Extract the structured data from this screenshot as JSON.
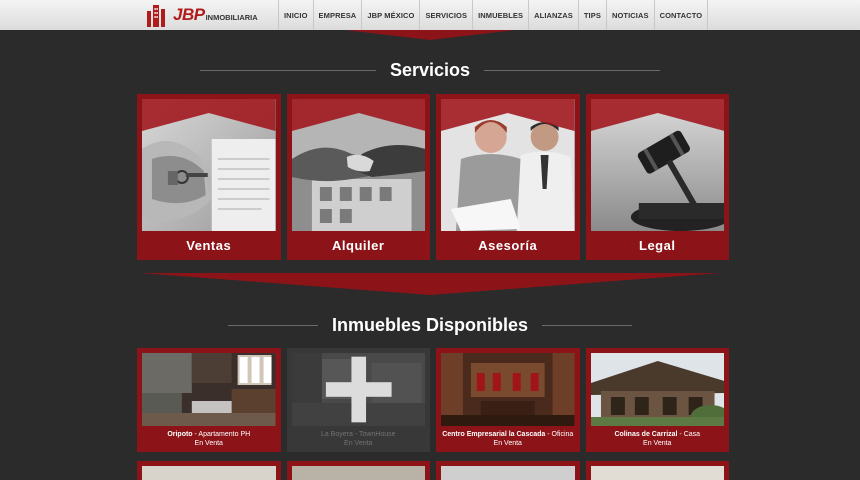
{
  "brand": {
    "name": "JBP",
    "tagline": "INMOBILIARIA",
    "color": "#b01c1c"
  },
  "nav": {
    "items": [
      {
        "label": "INICIO"
      },
      {
        "label": "EMPRESA"
      },
      {
        "label": "JBP MÉXICO"
      },
      {
        "label": "SERVICIOS"
      },
      {
        "label": "INMUEBLES"
      },
      {
        "label": "ALIANZAS"
      },
      {
        "label": "TIPS"
      },
      {
        "label": "NOTICIAS"
      },
      {
        "label": "CONTACTO"
      }
    ]
  },
  "services": {
    "title": "Servicios",
    "items": [
      {
        "label": "Ventas",
        "icon": "keys-handing-photo"
      },
      {
        "label": "Alquiler",
        "icon": "handshake-photo"
      },
      {
        "label": "Asesoría",
        "icon": "consulting-people-photo"
      },
      {
        "label": "Legal",
        "icon": "gavel-photo"
      }
    ]
  },
  "properties": {
    "title": "Inmuebles Disponibles",
    "items": [
      {
        "name": "Oripoto",
        "type": " - Apartamento PH",
        "status": "En Venta",
        "icon": "living-room-photo"
      },
      {
        "name": "La Boyera",
        "type": " - TownHouse",
        "status": "En Venta",
        "icon": "plus-icon"
      },
      {
        "name": "Centro Empresarial la Cascada",
        "type": " - Oficina",
        "status": "En Venta",
        "icon": "office-interior-photo"
      },
      {
        "name": "Colinas de Carrizal",
        "type": " - Casa",
        "status": "En Venta",
        "icon": "house-exterior-photo"
      }
    ]
  },
  "colors": {
    "accent": "#8c1418",
    "background": "#2b2b2b",
    "header": "#e8e8e8"
  }
}
